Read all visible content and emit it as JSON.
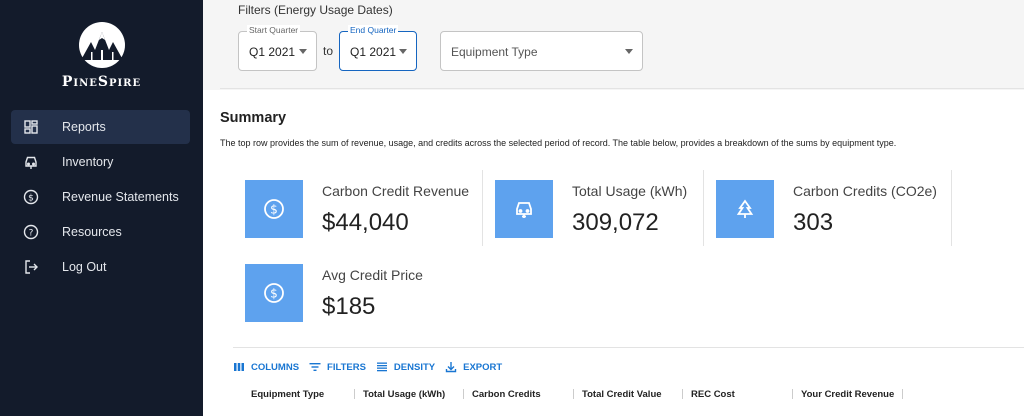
{
  "brand": {
    "name": "PineSpire"
  },
  "sidebar": {
    "items": [
      {
        "label": "Reports",
        "icon": "dashboard-icon",
        "active": true
      },
      {
        "label": "Inventory",
        "icon": "car-icon"
      },
      {
        "label": "Revenue Statements",
        "icon": "dollar-icon"
      },
      {
        "label": "Resources",
        "icon": "help-icon"
      },
      {
        "label": "Log Out",
        "icon": "logout-icon"
      }
    ]
  },
  "filters": {
    "title": "Filters (Energy Usage Dates)",
    "start_quarter": {
      "label": "Start Quarter",
      "value": "Q1 2021"
    },
    "to_text": "to",
    "end_quarter": {
      "label": "End Quarter",
      "value": "Q1 2021"
    },
    "equipment_type": {
      "placeholder": "Equipment Type"
    }
  },
  "summary": {
    "title": "Summary",
    "description": "The top row provides the sum of revenue, usage, and credits across the selected period of record. The table below, provides a breakdown of the sums by equipment type.",
    "stats": [
      {
        "label": "Carbon Credit Revenue",
        "value": "$44,040",
        "icon": "dollar-icon"
      },
      {
        "label": "Total Usage (kWh)",
        "value": "309,072",
        "icon": "car-icon"
      },
      {
        "label": "Carbon Credits (CO2e)",
        "value": "303",
        "icon": "tree-icon"
      },
      {
        "label": "Avg Credit Price",
        "value": "$185",
        "icon": "dollar-icon"
      }
    ]
  },
  "grid": {
    "toolbar": {
      "columns": "COLUMNS",
      "filters": "FILTERS",
      "density": "DENSITY",
      "export": "EXPORT"
    },
    "columns": [
      "Equipment Type",
      "Total Usage (kWh)",
      "Carbon Credits",
      "Total Credit Value",
      "REC Cost",
      "Your Credit Revenue"
    ]
  },
  "colors": {
    "sidebar_bg": "#131b2b",
    "accent": "#1976d2",
    "tile": "#5ea2ee"
  }
}
